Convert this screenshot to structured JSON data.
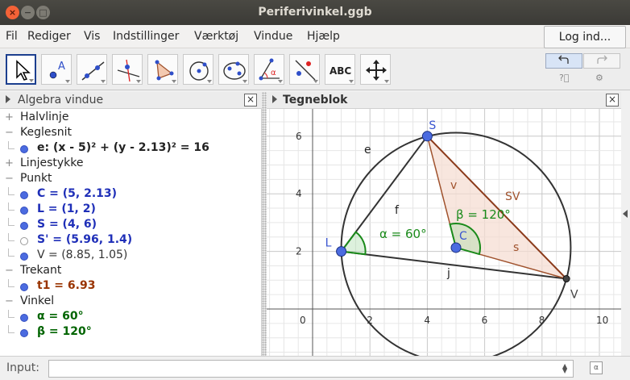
{
  "window": {
    "title": "Periferivinkel.ggb"
  },
  "menu": [
    "Fil",
    "Rediger",
    "Vis",
    "Indstillinger",
    "Værktøj",
    "Vindue",
    "Hjælp"
  ],
  "login_label": "Log ind...",
  "toolbar": {
    "tools": [
      "move-tool",
      "point-tool",
      "line-tool",
      "perpendicular-line-tool",
      "polygon-tool",
      "circle-tool",
      "conic-tool",
      "angle-tool",
      "reflect-tool",
      "text-tool",
      "move-graphics-tool"
    ],
    "text_tool_label": "ABC",
    "point_tool_label": "A",
    "angle_tool_label": "α"
  },
  "algebra": {
    "title": "Algebra vindue",
    "rows": [
      {
        "type": "cat",
        "exp": "+",
        "label": "Halvlinje"
      },
      {
        "type": "cat",
        "exp": "−",
        "label": "Keglesnit"
      },
      {
        "type": "obj",
        "text": "e: (x - 5)² + (y - 2.13)² = 16",
        "color": "#222222",
        "dot": "#4b6be0",
        "filled": true
      },
      {
        "type": "cat",
        "exp": "+",
        "label": "Linjestykke"
      },
      {
        "type": "cat",
        "exp": "−",
        "label": "Punkt"
      },
      {
        "type": "obj",
        "text": "C = (5, 2.13)",
        "color": "#1f2fb8",
        "dot": "#4b6be0",
        "filled": true
      },
      {
        "type": "obj",
        "text": "L = (1, 2)",
        "color": "#1f2fb8",
        "dot": "#4b6be0",
        "filled": true
      },
      {
        "type": "obj",
        "text": "S = (4, 6)",
        "color": "#1f2fb8",
        "dot": "#4b6be0",
        "filled": true
      },
      {
        "type": "obj",
        "text": "S' = (5.96, 1.4)",
        "color": "#1f2fb8",
        "dot": "#ffffff",
        "filled": false
      },
      {
        "type": "obj",
        "text": "V = (8.85, 1.05)",
        "color": "#333333",
        "dot": "#4b6be0",
        "filled": true,
        "normal": true
      },
      {
        "type": "cat",
        "exp": "−",
        "label": "Trekant"
      },
      {
        "type": "obj",
        "text": "t1 = 6.93",
        "color": "#993300",
        "dot": "#4b6be0",
        "filled": true
      },
      {
        "type": "cat",
        "exp": "−",
        "label": "Vinkel"
      },
      {
        "type": "obj",
        "text": "α = 60°",
        "color": "#006400",
        "dot": "#4b6be0",
        "filled": true
      },
      {
        "type": "obj",
        "text": "β = 120°",
        "color": "#006400",
        "dot": "#4b6be0",
        "filled": true
      }
    ]
  },
  "graphics": {
    "title": "Tegneblok",
    "xticks": [
      "0",
      "2",
      "4",
      "6",
      "8",
      "10"
    ],
    "yticks": [
      "2",
      "4",
      "6"
    ],
    "points": {
      "S": {
        "label": "S",
        "x": 4,
        "y": 6
      },
      "L": {
        "label": "L",
        "x": 1,
        "y": 2
      },
      "C": {
        "label": "C",
        "x": 5,
        "y": 2.13
      },
      "V": {
        "label": "V",
        "x": 8.85,
        "y": 1.05
      }
    },
    "circle": {
      "cx": 5,
      "cy": 2.13,
      "r": 4,
      "label": "e"
    },
    "labels": {
      "f": "f",
      "j": "j",
      "v": "v",
      "s": "s",
      "sv": "SV",
      "alpha": "α = 60°",
      "beta": "β = 120°"
    },
    "colors": {
      "triangle_fill": "#f5dcd0",
      "triangle_stroke": "#a0522d",
      "angle": "#1a8a1a",
      "point": "#4b6be0",
      "circle": "#333333"
    }
  },
  "input": {
    "label": "Input:",
    "value": ""
  }
}
